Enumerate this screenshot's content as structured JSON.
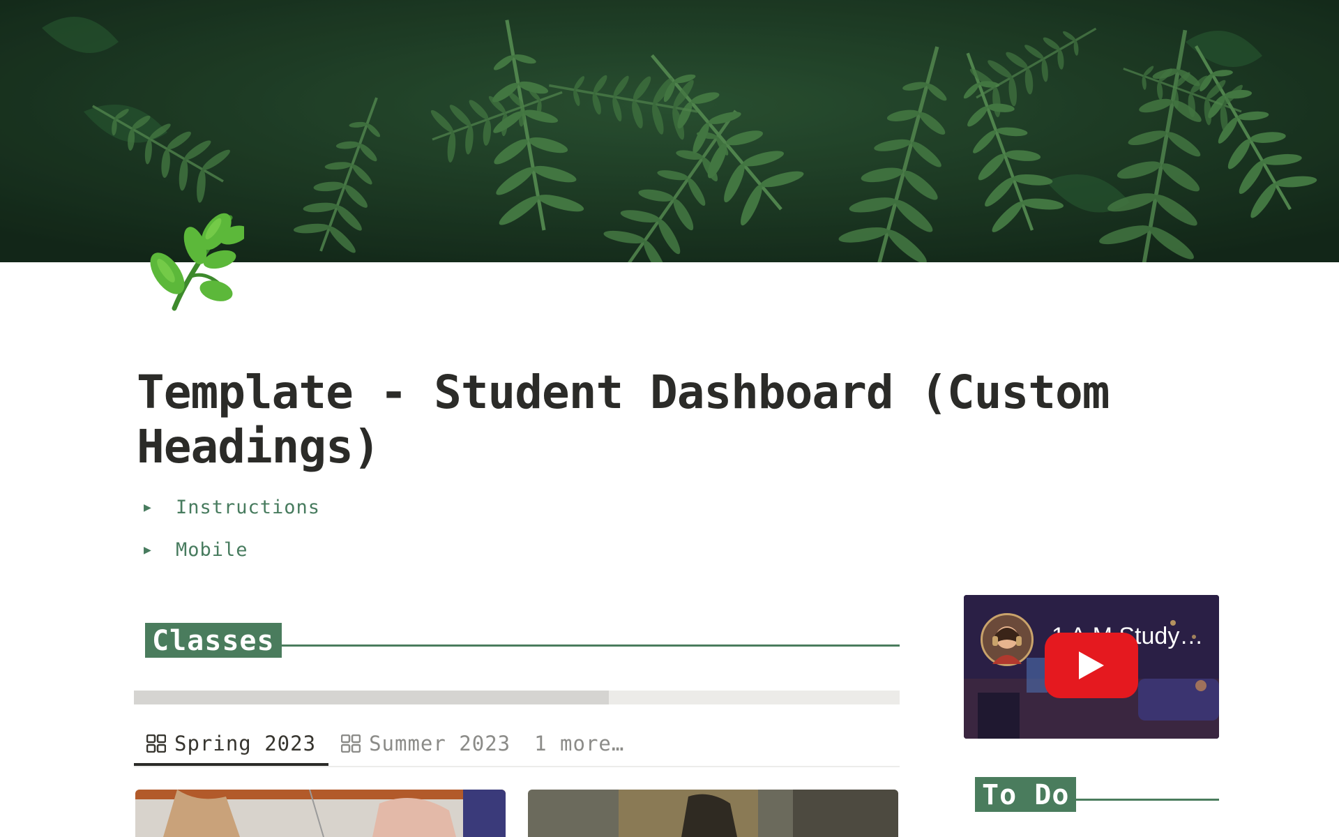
{
  "page": {
    "title": "Template - Student Dashboard (Custom Headings)"
  },
  "toggles": [
    {
      "label": "Instructions"
    },
    {
      "label": "Mobile"
    }
  ],
  "sections": {
    "classes": {
      "label": "Classes"
    },
    "todo": {
      "label": "To Do"
    }
  },
  "classes_progress": {
    "fraction": 0.62
  },
  "tabs": [
    {
      "label": "Spring 2023",
      "active": true
    },
    {
      "label": "Summer 2023",
      "active": false
    }
  ],
  "more_tab": {
    "label": "1 more…"
  },
  "video": {
    "title": "1 A.M Study…"
  },
  "colors": {
    "accent": "#4a7c5d",
    "toggle_text": "#477b5e",
    "title_text": "#2b2b28",
    "youtube_red": "#e5191f"
  },
  "icons": [
    "leaf-page-icon",
    "toggle-triangle-icon",
    "gallery-grid-icon",
    "play-icon"
  ]
}
